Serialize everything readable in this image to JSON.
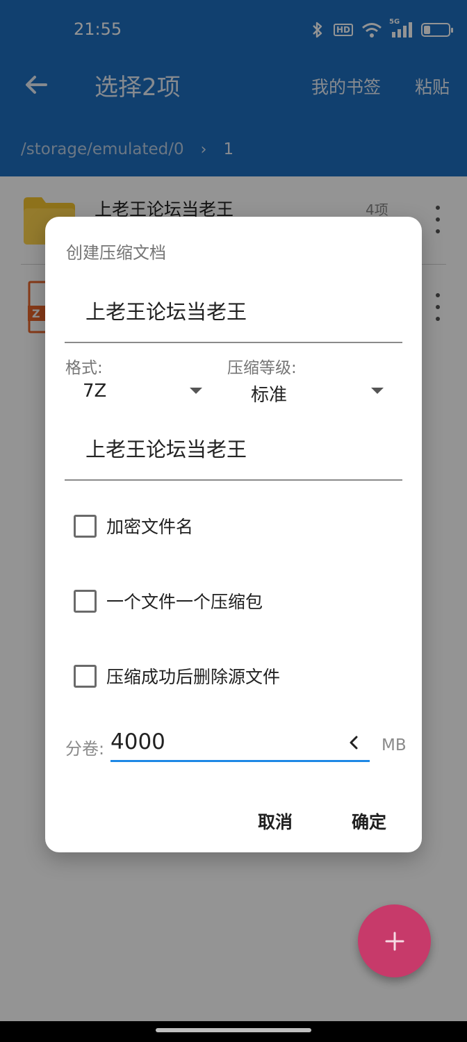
{
  "status_bar": {
    "time": "21:55",
    "network_label": "5G",
    "hd_label": "HD",
    "battery_level": 0.25,
    "icons": [
      "bluetooth-icon",
      "hd-icon",
      "wifi-icon",
      "signal-icon",
      "battery-icon"
    ]
  },
  "app_bar": {
    "title": "选择2项",
    "bookmarks_label": "我的书签",
    "paste_label": "粘贴",
    "path": "/storage/emulated/0",
    "path_current": "1",
    "color": "#1e6fbf"
  },
  "file_list": [
    {
      "name": "上老王论坛当老王",
      "count": "4项",
      "icon": "folder-icon"
    },
    {
      "name": "",
      "count": "",
      "icon": "zip-file-icon"
    }
  ],
  "dialog": {
    "title": "创建压缩文档",
    "archive_name": "上老王论坛当老王",
    "format_label": "格式:",
    "format_value": "7Z",
    "level_label": "压缩等级:",
    "level_value": "标准",
    "second_name": "上老王论坛当老王",
    "options": [
      {
        "label": "加密文件名",
        "checked": false
      },
      {
        "label": "一个文件一个压缩包",
        "checked": false
      },
      {
        "label": "压缩成功后删除源文件",
        "checked": false
      }
    ],
    "volume_label": "分卷:",
    "volume_value": "4000",
    "volume_unit": "MB",
    "cancel_label": "取消",
    "ok_label": "确定"
  },
  "fab_color": "#c73a6a",
  "accent_color": "#1e88e5"
}
